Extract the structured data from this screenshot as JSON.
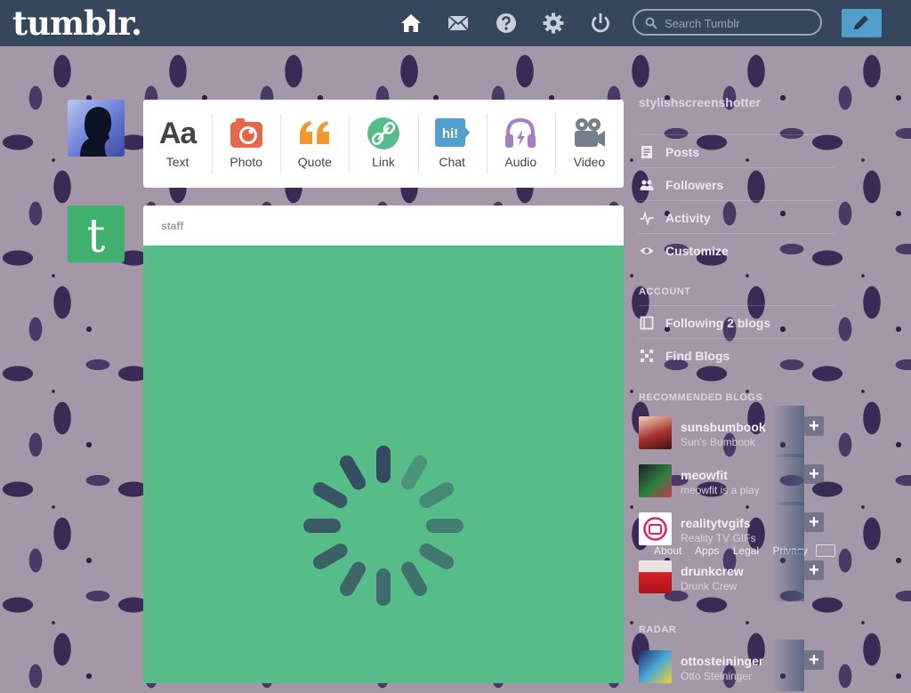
{
  "header": {
    "logo": "tumblr.",
    "search_placeholder": "Search Tumblr"
  },
  "post_types": [
    {
      "label": "Text",
      "icon": "text-aa-icon",
      "glyph": "Aa"
    },
    {
      "label": "Photo",
      "icon": "camera-icon"
    },
    {
      "label": "Quote",
      "icon": "quote-icon"
    },
    {
      "label": "Link",
      "icon": "link-icon"
    },
    {
      "label": "Chat",
      "icon": "chat-icon",
      "glyph": "hi!"
    },
    {
      "label": "Audio",
      "icon": "headphones-icon"
    },
    {
      "label": "Video",
      "icon": "video-camera-icon"
    }
  ],
  "post": {
    "author": "staff"
  },
  "sidebar": {
    "blog_name": "stylishscreenshotter",
    "items": [
      {
        "label": "Posts",
        "icon": "document-icon"
      },
      {
        "label": "Followers",
        "icon": "people-icon"
      },
      {
        "label": "Activity",
        "icon": "activity-icon"
      },
      {
        "label": "Customize",
        "icon": "eye-icon"
      }
    ],
    "account_heading": "ACCOUNT",
    "account_items": [
      {
        "label": "Following 2 blogs",
        "icon": "book-icon"
      },
      {
        "label": "Find Blogs",
        "icon": "find-blogs-icon"
      }
    ],
    "recommended_heading": "RECOMMENDED BLOGS",
    "recommended": [
      {
        "name": "sunsbumbook",
        "tagline": "Sun's Bumbook"
      },
      {
        "name": "meowfit",
        "tagline": "meowfit is a play"
      },
      {
        "name": "realitytvgifs",
        "tagline": "Reality TV GIFs"
      },
      {
        "name": "drunkcrew",
        "tagline": "Drunk Crew"
      },
      {
        "name": "ottosteininger",
        "tagline": "Otto Steininger"
      }
    ],
    "footer_links": [
      "About",
      "Apps",
      "Legal",
      "Privacy"
    ],
    "radar_heading": "RADAR"
  },
  "colors": {
    "header_bg": "#36465d",
    "compose_bg": "#529ecc",
    "post_media_bg": "#56bd89",
    "photo": "#e6674a",
    "quote": "#f2992e",
    "link": "#56bc8a",
    "chat": "#529ecc",
    "audio": "#a77dc2",
    "video": "#748089"
  }
}
